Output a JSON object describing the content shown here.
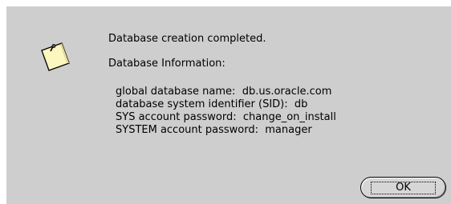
{
  "dialog": {
    "icon": "note-icon",
    "message": "Database creation completed.",
    "info_heading": "Database Information:",
    "details": [
      "global database name:  db.us.oracle.com",
      "database system identifier (SID):  db",
      "SYS account password:  change_on_install",
      "SYSTEM account password:  manager"
    ],
    "ok_label": "OK"
  },
  "colors": {
    "background": "#cecece",
    "note_fill": "#fbf7be"
  }
}
